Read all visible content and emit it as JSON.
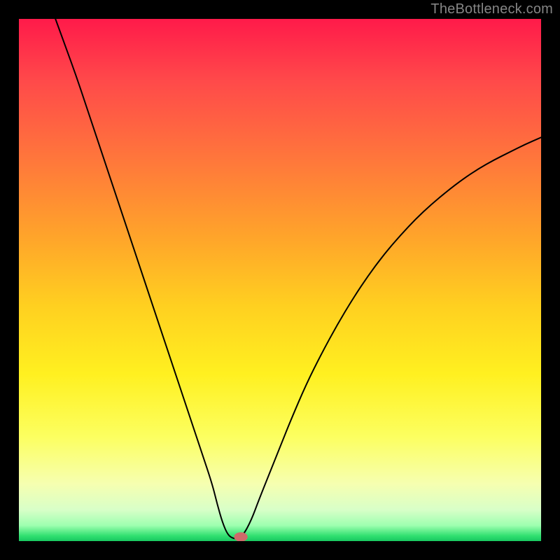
{
  "attribution": "TheBottleneck.com",
  "chart_data": {
    "type": "line",
    "title": "",
    "xlabel": "",
    "ylabel": "",
    "xlim": [
      0,
      100
    ],
    "ylim": [
      0,
      100
    ],
    "min_point": {
      "x": 41,
      "y": 0
    },
    "curve_points": [
      {
        "x": 7.0,
        "y": 100.0
      },
      {
        "x": 9.0,
        "y": 94.5
      },
      {
        "x": 11.0,
        "y": 89.0
      },
      {
        "x": 13.0,
        "y": 83.0
      },
      {
        "x": 15.0,
        "y": 77.0
      },
      {
        "x": 17.0,
        "y": 71.0
      },
      {
        "x": 19.0,
        "y": 65.0
      },
      {
        "x": 21.0,
        "y": 59.0
      },
      {
        "x": 23.0,
        "y": 53.0
      },
      {
        "x": 25.0,
        "y": 47.0
      },
      {
        "x": 27.0,
        "y": 41.0
      },
      {
        "x": 29.0,
        "y": 35.0
      },
      {
        "x": 31.0,
        "y": 29.0
      },
      {
        "x": 33.0,
        "y": 23.0
      },
      {
        "x": 35.0,
        "y": 17.0
      },
      {
        "x": 37.0,
        "y": 11.0
      },
      {
        "x": 38.0,
        "y": 7.0
      },
      {
        "x": 39.0,
        "y": 3.5
      },
      {
        "x": 40.0,
        "y": 1.2
      },
      {
        "x": 41.0,
        "y": 0.5
      },
      {
        "x": 42.0,
        "y": 0.5
      },
      {
        "x": 43.0,
        "y": 1.2
      },
      {
        "x": 44.5,
        "y": 4.0
      },
      {
        "x": 46.0,
        "y": 8.0
      },
      {
        "x": 48.0,
        "y": 13.0
      },
      {
        "x": 50.0,
        "y": 18.0
      },
      {
        "x": 52.0,
        "y": 23.0
      },
      {
        "x": 55.0,
        "y": 30.0
      },
      {
        "x": 58.0,
        "y": 36.0
      },
      {
        "x": 61.0,
        "y": 41.5
      },
      {
        "x": 64.0,
        "y": 46.5
      },
      {
        "x": 67.0,
        "y": 51.0
      },
      {
        "x": 70.0,
        "y": 55.0
      },
      {
        "x": 73.0,
        "y": 58.5
      },
      {
        "x": 76.0,
        "y": 61.7
      },
      {
        "x": 79.0,
        "y": 64.5
      },
      {
        "x": 82.0,
        "y": 67.0
      },
      {
        "x": 85.0,
        "y": 69.3
      },
      {
        "x": 88.0,
        "y": 71.3
      },
      {
        "x": 91.0,
        "y": 73.0
      },
      {
        "x": 94.0,
        "y": 74.5
      },
      {
        "x": 97.0,
        "y": 76.0
      },
      {
        "x": 100.0,
        "y": 77.3
      }
    ],
    "marker": {
      "x": 42.5,
      "y": 0.8,
      "color": "#d06a6a"
    },
    "gradient_stops": [
      {
        "pos": 0,
        "color": "#ff1a4a"
      },
      {
        "pos": 12,
        "color": "#ff4a4a"
      },
      {
        "pos": 28,
        "color": "#ff7a3a"
      },
      {
        "pos": 42,
        "color": "#ffa52a"
      },
      {
        "pos": 55,
        "color": "#ffd020"
      },
      {
        "pos": 68,
        "color": "#fff020"
      },
      {
        "pos": 80,
        "color": "#fcff60"
      },
      {
        "pos": 89,
        "color": "#f6ffb0"
      },
      {
        "pos": 94,
        "color": "#d8ffc8"
      },
      {
        "pos": 97,
        "color": "#9effb0"
      },
      {
        "pos": 99,
        "color": "#30e070"
      },
      {
        "pos": 100,
        "color": "#18c860"
      }
    ]
  }
}
